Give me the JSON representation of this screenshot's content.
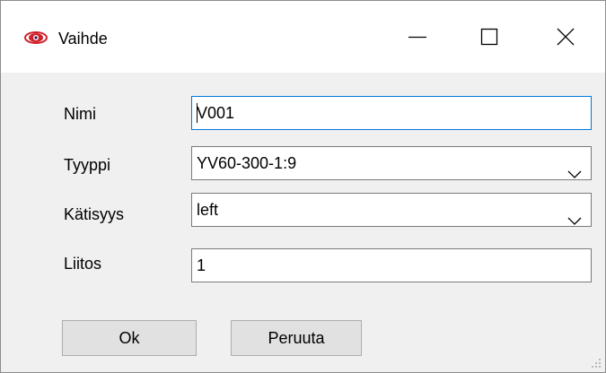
{
  "window": {
    "title": "Vaihde",
    "icon": "eye-icon",
    "controls": [
      "minimize-icon",
      "maximize-icon",
      "close-icon"
    ]
  },
  "form": {
    "name_label": "Nimi",
    "name_value": "V001",
    "type_label": "Tyyppi",
    "type_value": "YV60-300-1:9",
    "hand_label": "Kätisyys",
    "hand_value": "left",
    "connection_label": "Liitos",
    "connection_value": "1"
  },
  "buttons": {
    "ok_label": "Ok",
    "cancel_label": "Peruuta"
  },
  "colors": {
    "focus_border": "#0078d7",
    "icon_red": "#d0202a",
    "dialog_background": "#f0f0f0"
  }
}
